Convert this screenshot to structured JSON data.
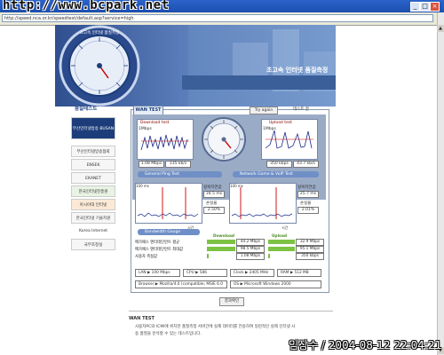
{
  "window": {
    "watermark": "http://www.bcpark.net",
    "controls": [
      "_",
      "□",
      "×"
    ]
  },
  "address_bar": {
    "url": "http://speed.nca.or.kr/speedtest/default.asp?service=high"
  },
  "header": {
    "dial_ring_text": "초고속 인터넷 품질측정",
    "title": "초고속 인터넷 품질측정"
  },
  "sidebar": {
    "title": "품질테스트",
    "logos": [
      "부산인터넷방송 BUSAN",
      "부산인터넷방송협회",
      "ENSEK",
      "EKANET",
      "한국인터넷진흥원",
      "아시아대 인터넷",
      "한국인터넷 기술지원",
      "Korea Internet Exchange",
      "국무조정실"
    ]
  },
  "panel": {
    "tab": "WAN TEST",
    "try_again": "Try again",
    "status": "테스트 끝",
    "download": {
      "title": "Download test",
      "scale": "1Mbps",
      "values": [
        "1.08 Mbps",
        "135 kb/s"
      ]
    },
    "upload": {
      "title": "Upload test",
      "scale": "1Mbps",
      "values": [
        "350 kbps",
        "43.7 kb/s"
      ]
    },
    "bars": {
      "ping_test": "General Ping Test",
      "game_test": "Network Game & VoIP Test",
      "bandwidth": "Bandwidth Gauge",
      "download": "Download",
      "upload": "Upload"
    },
    "ping": {
      "scale": "100 ms",
      "delay_label": "왕복지연값",
      "delay": "34.5 ms",
      "loss_label": "손실율",
      "loss": "2.50%",
      "time_label": "시간"
    },
    "game": {
      "scale": "100 ms",
      "delay_label": "왕복지연값",
      "delay": "25.7 ms",
      "loss_label": "손실율",
      "loss": "2.01%",
      "time_label": "시간"
    },
    "gauge_rows": [
      {
        "label": "메가패스 엔터테인먼트 평균",
        "download": "44.2 Mbps",
        "upload": "32.9 Mbps"
      },
      {
        "label": "메가패스 엔터테인먼트 최대값",
        "download": "98.5 Mbps",
        "upload": "95.1 Mbps"
      },
      {
        "label": "사용자 측정값",
        "download": "1.08 Mbps",
        "upload": "350 kbps"
      }
    ],
    "system": {
      "lan": "LAN ▶ 100 Mbps",
      "cpu": "CPU ▶ 586",
      "clock": "Clock ▶ 2405 MHz",
      "ram": "RAM ▶ 512 MB",
      "browser": "Browser ▶ Mozilla/4.0 (compatible; MSIE 6.0",
      "os": "OS ▶ Microsoft Windows 2000"
    }
  },
  "result_button": "결과확인",
  "description": {
    "title": "WAN TEST",
    "line1": "사용자PC와 ICMI에 위치한 품질측정 서버간에 실제 데이터를 전송하여 일련적인 실제 인터넷 사",
    "line2": "용 품질을 분석할 수 있는 테스트입니다."
  },
  "timestamp": "임장수 / 2004-08-12 22:04:21",
  "colors": {
    "accent": "#2f4f8f",
    "series": "#1a2a8a",
    "peak": "#cc0000",
    "gauge_fill": "#7cc243"
  }
}
